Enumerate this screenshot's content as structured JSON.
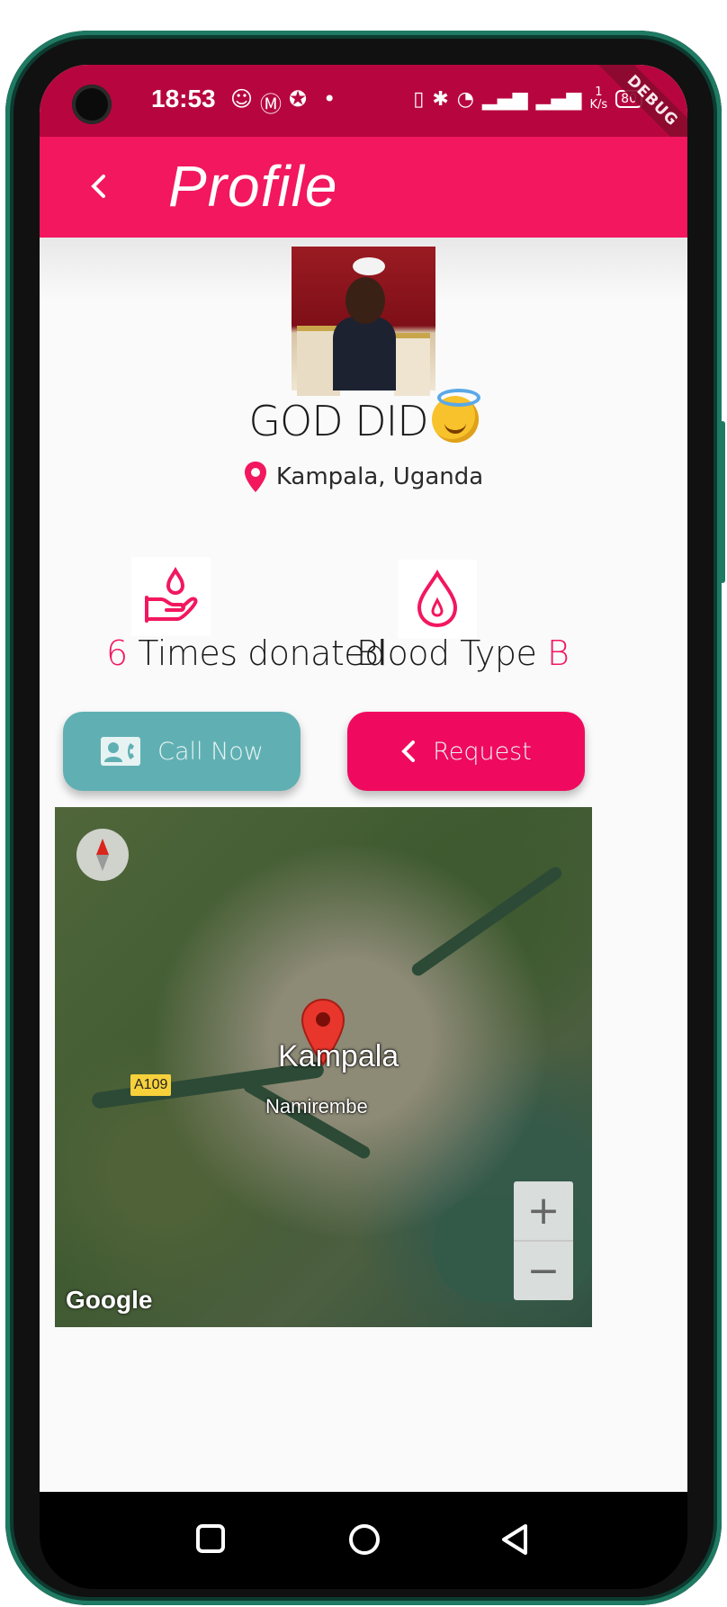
{
  "status_bar": {
    "time": "18:53",
    "debug_label": "DEBUG",
    "net_speed_top": "1",
    "net_speed_unit": "K/s",
    "battery": "80",
    "icons": [
      "app-notification-icon",
      "tm-icon",
      "star-icon",
      "dot-icon",
      "vibrate-icon",
      "bluetooth-icon",
      "wifi-icon",
      "signal-icon",
      "signal-icon",
      "battery-icon"
    ]
  },
  "app_bar": {
    "title": "Profile",
    "back_icon": "chevron-left-icon"
  },
  "profile": {
    "name": "GOD DID",
    "name_emoji": "smiling-face-with-halo",
    "location": "Kampala, Uganda"
  },
  "stats": {
    "donations_count": "6",
    "donations_label": "Times donated",
    "blood_type_label": "Blood Type",
    "blood_type_value": "B"
  },
  "buttons": {
    "call_label": "Call Now",
    "request_label": "Request"
  },
  "map": {
    "city_label": "Kampala",
    "area_label": "Namirembe",
    "road_label": "A109",
    "zoom_in": "+",
    "zoom_out": "−",
    "attribution": "Google"
  },
  "colors": {
    "status_bar": "#b7063f",
    "app_bar": "#f2175f",
    "accent": "#f2175f",
    "call_button": "#60b0b3",
    "request_button": "#f00a5f"
  }
}
